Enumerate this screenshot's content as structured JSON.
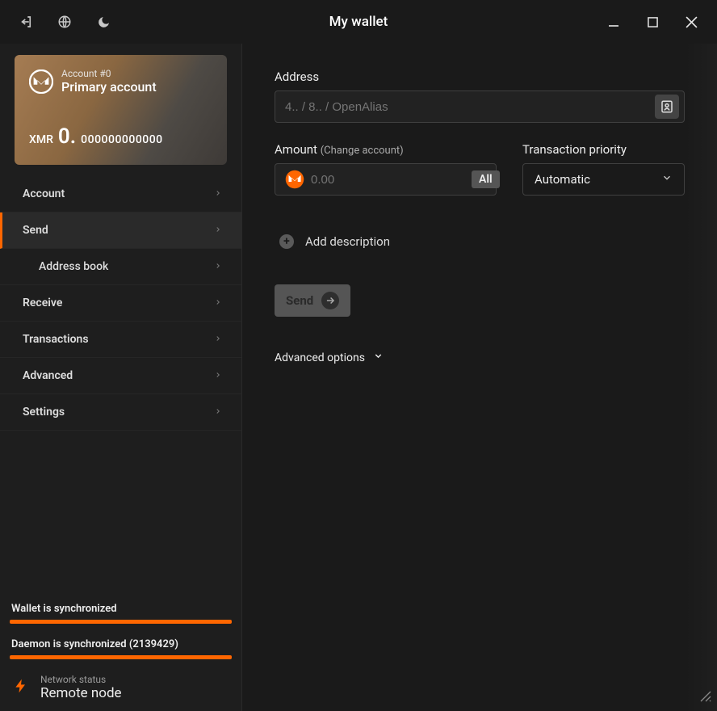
{
  "window": {
    "title": "My wallet"
  },
  "account_card": {
    "account_label": "Account #0",
    "account_name": "Primary account",
    "currency": "XMR",
    "balance_whole": "0.",
    "balance_decimals": "000000000000"
  },
  "nav": {
    "items": [
      {
        "label": "Account",
        "sub": false,
        "active": false
      },
      {
        "label": "Send",
        "sub": false,
        "active": true
      },
      {
        "label": "Address book",
        "sub": true,
        "active": false
      },
      {
        "label": "Receive",
        "sub": false,
        "active": false
      },
      {
        "label": "Transactions",
        "sub": false,
        "active": false
      },
      {
        "label": "Advanced",
        "sub": false,
        "active": false
      },
      {
        "label": "Settings",
        "sub": false,
        "active": false
      }
    ]
  },
  "sync": {
    "wallet_label": "Wallet is synchronized",
    "daemon_label": "Daemon is synchronized (2139429)"
  },
  "network": {
    "caption": "Network status",
    "value": "Remote node"
  },
  "send_form": {
    "address_label": "Address",
    "address_placeholder": "4.. / 8.. / OpenAlias",
    "amount_label": "Amount",
    "amount_link": "(Change account)",
    "amount_placeholder": "0.00",
    "all_label": "All",
    "priority_label": "Transaction priority",
    "priority_value": "Automatic",
    "add_desc": "Add description",
    "send_button": "Send",
    "advanced_options": "Advanced options"
  }
}
